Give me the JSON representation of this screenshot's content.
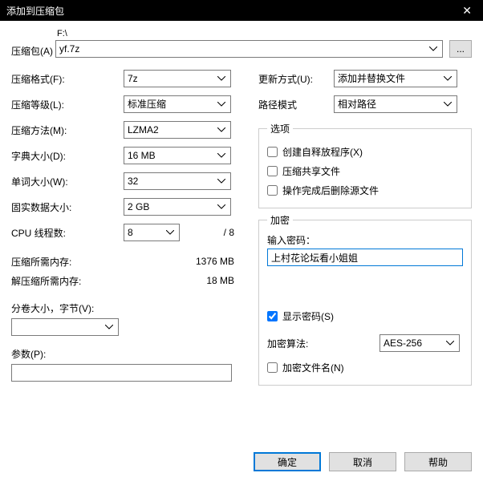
{
  "window": {
    "title": "添加到压缩包"
  },
  "archive": {
    "label": "压缩包(A)",
    "path_prefix": "F:\\",
    "filename": "yf.7z",
    "browse": "..."
  },
  "left": {
    "format": {
      "label": "压缩格式(F):",
      "value": "7z"
    },
    "level": {
      "label": "压缩等级(L):",
      "value": "标准压缩"
    },
    "method": {
      "label": "压缩方法(M):",
      "value": "LZMA2"
    },
    "dict": {
      "label": "字典大小(D):",
      "value": "16 MB"
    },
    "word": {
      "label": "单词大小(W):",
      "value": "32"
    },
    "solid": {
      "label": "固实数据大小:",
      "value": "2 GB"
    },
    "cpu": {
      "label": "CPU 线程数:",
      "value": "8",
      "suffix": "/ 8"
    },
    "mem_comp": {
      "label": "压缩所需内存:",
      "value": "1376 MB"
    },
    "mem_decomp": {
      "label": "解压缩所需内存:",
      "value": "18 MB"
    },
    "split": {
      "label": "分卷大小，字节(V):",
      "value": ""
    },
    "params": {
      "label": "参数(P):",
      "value": ""
    }
  },
  "right": {
    "update": {
      "label": "更新方式(U):",
      "value": "添加并替换文件"
    },
    "pathmode": {
      "label": "路径模式",
      "value": "相对路径"
    },
    "options": {
      "legend": "选项",
      "sfx": "创建自释放程序(X)",
      "shared": "压缩共享文件",
      "deleteafter": "操作完成后删除源文件"
    },
    "encrypt": {
      "legend": "加密",
      "pw_label": "输入密码：",
      "pw_value": "上村花论坛看小姐姐",
      "show_pw": "显示密码(S)",
      "algo_label": "加密算法:",
      "algo_value": "AES-256",
      "enc_names": "加密文件名(N)"
    }
  },
  "buttons": {
    "ok": "确定",
    "cancel": "取消",
    "help": "帮助"
  }
}
